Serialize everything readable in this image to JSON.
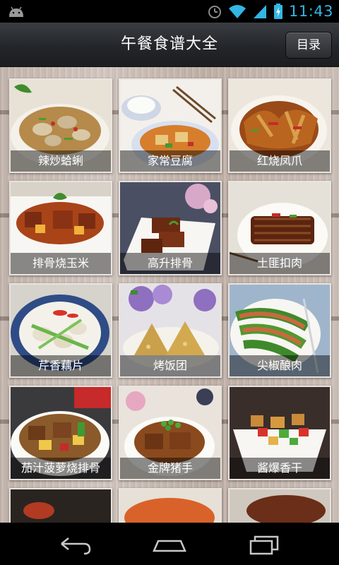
{
  "status_bar": {
    "time": "11:43",
    "icons": [
      "android-icon",
      "alarm-icon",
      "wifi-icon",
      "signal-icon",
      "battery-icon"
    ]
  },
  "header": {
    "title": "午餐食谱大全",
    "menu_button": "目录"
  },
  "recipes": [
    {
      "name": "辣炒蛤蜊"
    },
    {
      "name": "家常豆腐"
    },
    {
      "name": "红烧凤爪"
    },
    {
      "name": "排骨烧玉米"
    },
    {
      "name": "高升排骨"
    },
    {
      "name": "土匪扣肉"
    },
    {
      "name": "芹香藕片"
    },
    {
      "name": "烤饭团"
    },
    {
      "name": "尖椒酿肉"
    },
    {
      "name": "茄汁菠萝烧排骨"
    },
    {
      "name": "金牌猪手"
    },
    {
      "name": "酱爆香干"
    },
    {
      "name": ""
    },
    {
      "name": ""
    },
    {
      "name": ""
    }
  ],
  "nav_bar": {
    "icons": [
      "back-icon",
      "home-icon",
      "recent-apps-icon"
    ]
  },
  "colors": {
    "status_accent": "#33b5e5",
    "header_bg": "#2a2d31",
    "wood_bg": "#cfc3bb"
  }
}
